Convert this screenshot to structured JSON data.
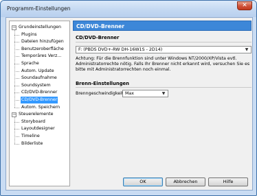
{
  "window": {
    "title": "Programm-Einstellungen",
    "close_glyph": "✕"
  },
  "tree": {
    "groups": [
      {
        "label": "Grundeinstellungen",
        "expander": "−",
        "items": [
          "Plugins",
          "Dateien hinzufügen",
          "Benutzeroberfläche",
          "Temporäres Verz...",
          "Sprache",
          "Autom. Update",
          "Soundaufnahme",
          "Soundsystem",
          "CD/DVD-Brenner",
          "CD/DVD-Brenner",
          "Autom. Speichern"
        ]
      },
      {
        "label": "Steuerelemente",
        "expander": "−",
        "items": [
          "Storyboard",
          "Layoutdesigner",
          "Timeline",
          "Bilderliste"
        ]
      }
    ],
    "selected": "CD/DVD-Brenner"
  },
  "panel": {
    "header": "CD/DVD-Brenner",
    "section1_title": "CD/DVD-Brenner",
    "device_combo": "F: (PBDS DVD+-RW DH-16W1S - 2D14)",
    "hint": "Achtung: Für die Brennfunktion sind unter Windows NT/2000/XP/Vista evtl. Administratorrechte nötig. Falls Ihr Brenner nicht erkannt wird, versuchen Sie es bitte mit Administratorrechten noch einmal.",
    "section2_title": "Brenn-Einstellungen",
    "speed_label": "Brenngeschwindigkeit:",
    "speed_value": "Max"
  },
  "buttons": {
    "ok": "OK",
    "cancel": "Abbrechen",
    "help": "Hilfe"
  },
  "icons": {
    "combo_arrow": "▼"
  }
}
